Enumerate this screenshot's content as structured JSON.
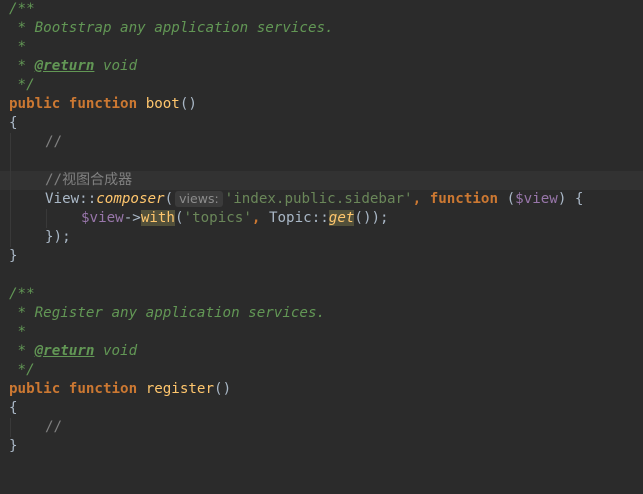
{
  "colors": {
    "background": "#2b2b2b",
    "current_line": "#323232",
    "doc_comment": "#629755",
    "keyword": "#cc7832",
    "function_name": "#ffc66d",
    "variable": "#9876aa",
    "string": "#6a8759",
    "comment": "#808080",
    "text": "#a9b7c6"
  },
  "boot_doc": {
    "open": "/**",
    "description": " * Bootstrap any application services.",
    "blank": " *",
    "star": " * ",
    "tag": "@return",
    "type": " void",
    "close": " */"
  },
  "boot_sig": {
    "kw_public": "public",
    "kw_function": "function",
    "name": "boot",
    "parens": "()"
  },
  "boot_body": {
    "open_brace": "{",
    "comment1": "//",
    "comment2_prefix": "//",
    "comment2_cjk": "视图合成器",
    "view_class": "View",
    "dcolon": "::",
    "composer": "composer",
    "paren_open": "(",
    "param_hint": "views:",
    "view_string": "'index.public.sidebar'",
    "comma": ",",
    "kw_function": "function",
    "closure_open": "(",
    "closure_var": "$view",
    "closure_close": ") {",
    "inner_var": "$view",
    "arrow": "->",
    "with": "with",
    "with_open": "(",
    "topics_string": "'topics'",
    "topic_class": "Topic",
    "topic_dcolon": "::",
    "get": "get",
    "inner_tail": "());",
    "close_closure": "});",
    "close_brace": "}"
  },
  "register_doc": {
    "open": "/**",
    "description": " * Register any application services.",
    "blank": " *",
    "star": " * ",
    "tag": "@return",
    "type": " void",
    "close": " */"
  },
  "register_sig": {
    "kw_public": "public",
    "kw_function": "function",
    "name": "register",
    "parens": "()"
  },
  "register_body": {
    "open_brace": "{",
    "comment1": "//",
    "close_brace": "}"
  }
}
